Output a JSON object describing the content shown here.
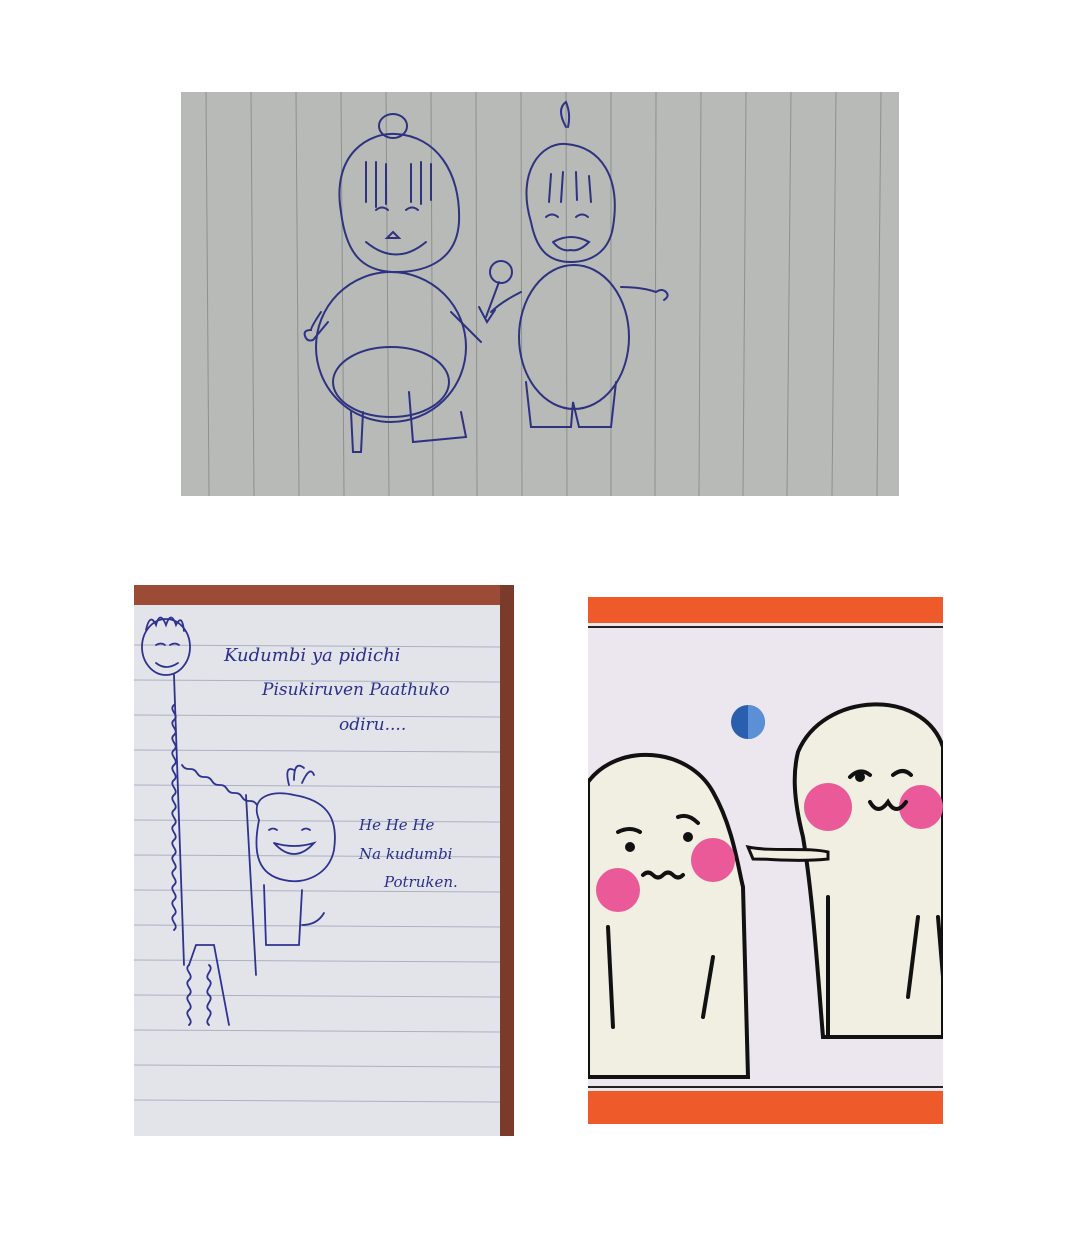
{
  "photos": {
    "top": {
      "subject": "pen sketch of two chubby cartoon figures holding a lollipop on lined notebook paper"
    },
    "bottom_left": {
      "lines": [
        "Kudumbi ya pidichi",
        "Pisukiruven Paathuko",
        "odiru....",
        "He He He",
        "Na kudumbi",
        "Potruken."
      ]
    },
    "bottom_right": {
      "subject": "colored drawing of two white blob characters with pink cheeks, one pinching the other's cheek, with a blue ball, orange border"
    }
  },
  "colors": {
    "page": "#ffffff",
    "paper_gray": "#b9bcb9",
    "ink_blue": "#2b2f8a",
    "notebook_paper": "#e4e6ec",
    "blob_white": "#f1eee2",
    "blob_cheek": "#ea5a98",
    "border_orange": "#ee5a2a",
    "ball_blue": "#2a5fb0"
  }
}
